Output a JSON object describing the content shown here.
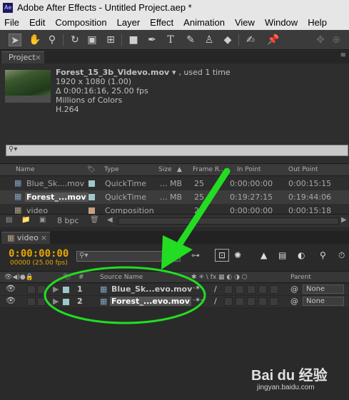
{
  "window": {
    "title": "Adobe After Effects - Untitled Project.aep *",
    "logo_text": "Ae"
  },
  "menu": [
    "File",
    "Edit",
    "Composition",
    "Layer",
    "Effect",
    "Animation",
    "View",
    "Window",
    "Help"
  ],
  "toolbar_icons": [
    "selection-tool",
    "hand-tool",
    "zoom-tool",
    "rotation-tool",
    "camera-tool",
    "pan-behind-tool",
    "rectangle-tool",
    "pen-tool",
    "type-tool",
    "brush-tool",
    "clone-stamp-tool",
    "eraser-tool",
    "roto-brush-tool",
    "puppet-pin-tool"
  ],
  "project": {
    "tab_label": "Project",
    "file": {
      "name": "Forest_15_3b_Videvo.mov",
      "used": ", used 1 time",
      "resolution": "1920 x 1080 (1.00)",
      "duration": "Δ 0:00:16:16, 25.00 fps",
      "colors": "Millions of Colors",
      "codec": "H.264"
    },
    "columns": {
      "name": "Name",
      "type": "Type",
      "size": "Size",
      "frame_rate": "Frame R...",
      "in_point": "In Point",
      "out_point": "Out Point"
    },
    "rows": [
      {
        "name": "Blue_Sk....mov",
        "type": "QuickTime",
        "size": "... MB",
        "fps": "25",
        "in": "0:00:00:00",
        "out": "0:00:15:15",
        "color": "#9fc8c8"
      },
      {
        "name": "Forest_...mov",
        "type": "QuickTime",
        "size": "... MB",
        "fps": "25",
        "in": "0:19:27:15",
        "out": "0:19:44:06",
        "color": "#9fc8c8"
      },
      {
        "name": "video",
        "type": "Composition",
        "size": "",
        "fps": "25",
        "in": "0:00:00:00",
        "out": "0:00:15:18",
        "color": "#c8a080"
      }
    ],
    "bpc": "8 bpc"
  },
  "timeline": {
    "tab_label": "video",
    "timecode": "0:00:00:00",
    "fps_label": "00000 (25.00 fps)",
    "columns": {
      "number": "#",
      "source_name": "Source Name",
      "parent": "Parent"
    },
    "layers": [
      {
        "index": "1",
        "name": "Blue_Sk...evo.mov",
        "parent": "None"
      },
      {
        "index": "2",
        "name": "Forest_...evo.mov",
        "parent": "None"
      }
    ]
  },
  "watermark": {
    "brand": "Bai du 经验",
    "url": "jingyan.baidu.com"
  },
  "annotation_colors": {
    "arrow": "#22dd22",
    "ellipse": "#22dd22"
  }
}
